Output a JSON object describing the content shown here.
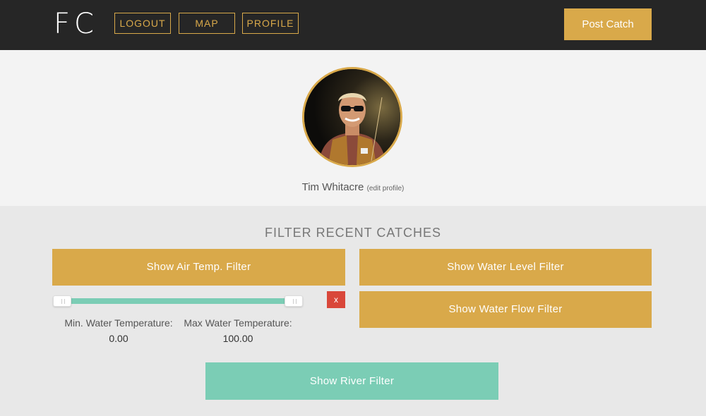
{
  "header": {
    "logo": "FC",
    "nav": {
      "logout": "LOGOUT",
      "map": "MAP",
      "profile": "PROFILE"
    },
    "post_catch": "Post Catch"
  },
  "profile": {
    "name": "Tim Whitacre",
    "edit_link": "(edit profile)"
  },
  "filters": {
    "title": "FILTER RECENT CATCHES",
    "air_temp_button": "Show Air Temp. Filter",
    "water_level_button": "Show Water Level Filter",
    "water_flow_button": "Show Water Flow Filter",
    "river_button": "Show River Filter",
    "close_label": "x",
    "water_temp": {
      "min_label": "Min. Water Temperature:",
      "max_label": "Max Water Temperature:",
      "min_value": "0.00",
      "max_value": "100.00"
    }
  },
  "colors": {
    "accent_gold": "#d9a94a",
    "accent_teal": "#7bcdb5",
    "danger_red": "#d9473a",
    "header_bg": "#262626"
  }
}
